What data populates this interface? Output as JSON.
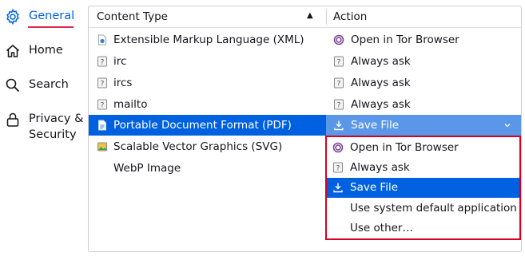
{
  "nav": {
    "items": [
      {
        "label": "General",
        "icon": "gear-icon"
      },
      {
        "label": "Home",
        "icon": "home-icon"
      },
      {
        "label": "Search",
        "icon": "search-icon"
      },
      {
        "label": "Privacy &",
        "label2": "Security",
        "icon": "lock-icon"
      }
    ]
  },
  "table": {
    "headers": {
      "content_type": "Content Type",
      "action": "Action"
    },
    "rows": [
      {
        "type": "Extensible Markup Language (XML)",
        "type_icon": "xml-file-icon",
        "action": "Open in Tor Browser",
        "action_icon": "tor-browser-icon"
      },
      {
        "type": "irc",
        "type_icon": "unknown-file-icon",
        "action": "Always ask",
        "action_icon": "unknown-file-icon"
      },
      {
        "type": "ircs",
        "type_icon": "unknown-file-icon",
        "action": "Always ask",
        "action_icon": "unknown-file-icon"
      },
      {
        "type": "mailto",
        "type_icon": "unknown-file-icon",
        "action": "Always ask",
        "action_icon": "unknown-file-icon"
      },
      {
        "type": "Portable Document Format (PDF)",
        "type_icon": "pdf-file-icon",
        "action": "Save File",
        "action_icon": "download-icon",
        "selected": true
      },
      {
        "type": "Scalable Vector Graphics (SVG)",
        "type_icon": "image-file-icon",
        "action": "",
        "action_icon": ""
      },
      {
        "type": "WebP Image",
        "type_icon": "",
        "action": "",
        "action_icon": ""
      }
    ]
  },
  "dropdown": {
    "options": [
      {
        "label": "Open in Tor Browser",
        "icon": "tor-browser-icon"
      },
      {
        "label": "Always ask",
        "icon": "unknown-file-icon"
      },
      {
        "label": "Save File",
        "icon": "download-icon",
        "selected": true
      },
      {
        "label": "Use system default application",
        "icon": ""
      },
      {
        "label": "Use other…",
        "icon": ""
      }
    ]
  },
  "colors": {
    "accent": "#0061e0",
    "highlight_border": "#d70022",
    "underline": "#e22850"
  }
}
